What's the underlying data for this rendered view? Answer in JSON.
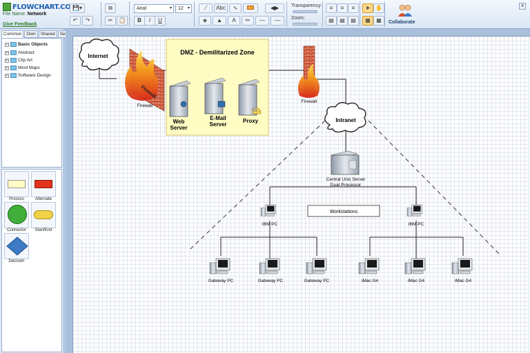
{
  "app": {
    "logo": "FLOWCHART.COM",
    "file_name_label": "File Name:",
    "file_name": "Network",
    "feedback": "Give Feedback"
  },
  "toolbar": {
    "font_family": "Arial",
    "font_size": "12",
    "bold": "B",
    "italic": "I",
    "underline": "U",
    "text_style_label": "Abc",
    "transparency_label": "Transparency:",
    "zoom_label": "Zoom:",
    "collaborate_label": "Collaborate",
    "close": "x"
  },
  "panel": {
    "tabs": [
      "Common",
      "Own",
      "Shared",
      "Search"
    ],
    "tree": [
      "Basic Objects",
      "Abstract",
      "Clip Art",
      "Mind Maps",
      "Software Design"
    ],
    "shapes": [
      "Process",
      "Alternate",
      "Connector",
      "Start/End",
      "Decision"
    ]
  },
  "diagram": {
    "internet": "Internet",
    "firewall_left_diag": "Firewall",
    "firewall_left": "Firewall",
    "dmz_title": "DMZ - Demilitarized Zone",
    "web_server_1": "Web",
    "web_server_2": "Server",
    "email_server_1": "E-Mail",
    "email_server_2": "Server",
    "proxy": "Proxy",
    "firewall_right": "Firewall",
    "intranet": "Intranet",
    "unix_server_1": "Central Unix Server",
    "unix_server_2": "Dual Processor",
    "workstations": "Workstations",
    "ibm_left": "IBM PC",
    "ibm_right": "IBM PC",
    "gateway_1": "Gateway PC",
    "gateway_2": "Gateway PC",
    "gateway_3": "Gateway PC",
    "imac_1": "iMac G4",
    "imac_2": "iMac G4",
    "imac_3": "iMac G4"
  },
  "colors": {
    "dmz_fill": "#fffcc4",
    "firewall_brick": "#c84a2a",
    "flame": "#f59a1a",
    "alternate_shape": "#e0331a",
    "connector_shape": "#3fae3a",
    "startend_shape": "#f2d24a",
    "decision_shape": "#3c7bc4"
  }
}
